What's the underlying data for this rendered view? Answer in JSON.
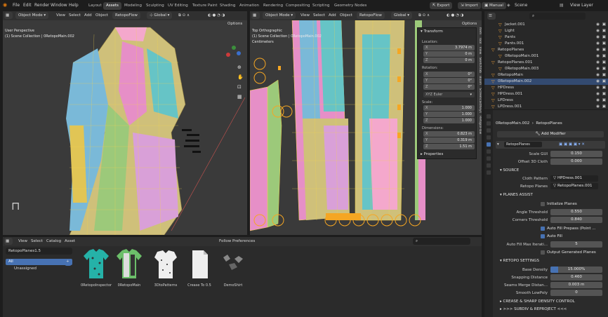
{
  "app": {
    "menus": [
      "File",
      "Edit",
      "Render",
      "Window",
      "Help"
    ],
    "workspaces": [
      "Layout",
      "Assets",
      "Modeling",
      "Sculpting",
      "UV Editing",
      "Texture Paint",
      "Shading",
      "Animation",
      "Rendering",
      "Compositing",
      "Scripting",
      "Geometry Nodes"
    ],
    "active_workspace": "Assets",
    "export": "Export",
    "import": "Import",
    "manual": "Manual",
    "scene": "Scene",
    "view_layer": "View Layer"
  },
  "vp_left": {
    "mode": "Object Mode",
    "menus": [
      "View",
      "Select",
      "Add",
      "Object"
    ],
    "tool": "RetopoFlow",
    "orient": "Global",
    "options": "Options",
    "overlay_title": "User Perspective",
    "overlay_sub": "(1) Scene Collection | 0RetopoMain.002"
  },
  "vp_right": {
    "mode": "Object Mode",
    "menus": [
      "View",
      "Select",
      "Add",
      "Object"
    ],
    "tool": "RetopoFlow",
    "orient": "Global",
    "options": "Options",
    "overlay_title": "Top Orthographic",
    "overlay_sub": "(1) Scene Collection | 0RetopoMain.002",
    "overlay_unit": "Centimeters",
    "side_tabs": [
      "Item",
      "Tool",
      "View",
      "Sketchfab",
      "Boom",
      "ScreencastKeys",
      "RetopoFlow"
    ]
  },
  "npanel": {
    "title": "Transform",
    "location_label": "Location:",
    "loc": [
      {
        "k": "X",
        "v": "3.7974 m"
      },
      {
        "k": "Y",
        "v": "0 m"
      },
      {
        "k": "Z",
        "v": "0 m"
      }
    ],
    "rotation_label": "Rotation:",
    "rot": [
      {
        "k": "X",
        "v": "0°"
      },
      {
        "k": "Y",
        "v": "0°"
      },
      {
        "k": "Z",
        "v": "0°"
      }
    ],
    "euler": "XYZ Euler",
    "scale_label": "Scale:",
    "scale": [
      {
        "k": "X",
        "v": "1.000"
      },
      {
        "k": "Y",
        "v": "1.000"
      },
      {
        "k": "Z",
        "v": "1.000"
      }
    ],
    "dim_label": "Dimensions:",
    "dim": [
      {
        "k": "X",
        "v": "0.823 m"
      },
      {
        "k": "Y",
        "v": "0.319 m"
      },
      {
        "k": "Z",
        "v": "1.51 m"
      }
    ],
    "properties": "Properties"
  },
  "outliner": {
    "search_placeholder": "",
    "rows": [
      {
        "name": "Jacket.001",
        "indent": 1,
        "sel": false
      },
      {
        "name": "Light",
        "indent": 1,
        "sel": false
      },
      {
        "name": "Pants",
        "indent": 1,
        "sel": false
      },
      {
        "name": "Pants.001",
        "indent": 1,
        "sel": false
      },
      {
        "name": "RetopoPlanes",
        "indent": 0,
        "sel": false
      },
      {
        "name": "0RetopoMain.001",
        "indent": 1,
        "sel": false
      },
      {
        "name": "RetopoPlanes.001",
        "indent": 0,
        "sel": false
      },
      {
        "name": "0RetopoMain.003",
        "indent": 1,
        "sel": false
      },
      {
        "name": "0RetopoMain",
        "indent": 0,
        "sel": false
      },
      {
        "name": "0RetopoMain.002",
        "indent": 0,
        "sel": true
      },
      {
        "name": "HPDress",
        "indent": 0,
        "sel": false
      },
      {
        "name": "HPDress.001",
        "indent": 0,
        "sel": false
      },
      {
        "name": "LPDress",
        "indent": 0,
        "sel": false
      },
      {
        "name": "LPDress.001",
        "indent": 0,
        "sel": false
      }
    ]
  },
  "props": {
    "breadcrumb_obj": "0RetopoMain.002",
    "breadcrumb_mod": "RetopoPlanes",
    "add_modifier": "Add Modifier",
    "modifier_name": "RetopoPlanes",
    "fields": [
      {
        "label": "Scale GUI",
        "value": "0.150"
      },
      {
        "label": "Offset 3D Cloth",
        "value": "0.000"
      }
    ],
    "source_header": "SOURCE",
    "cloth_pattern_label": "Cloth Pattern",
    "cloth_pattern": "HPDress.001",
    "retopo_planes_label": "Retopo Planes",
    "retopo_planes": "RetopoPlanes.001",
    "planes_assist_header": "PLANES ASSIST",
    "initialize_planes": "Initialize Planes",
    "angle_label": "Angle Threshold",
    "angle": "0.550",
    "corners_label": "Corners Threshold",
    "corners": "0.840",
    "auto_fill_prepass": "Auto Fill Prepass (Point ...",
    "auto_fill": "Auto Fill",
    "max_iter_label": "Auto Fill Max Iterati...",
    "max_iter": "5",
    "output_generated": "Output Generated Planes",
    "retopo_settings_header": "RETOPO SETTINGS",
    "base_density_label": "Base Density",
    "base_density": "15.000%",
    "base_density_frac": 0.15,
    "snapping_label": "Snapping Distance",
    "snapping": "0.460",
    "seams_label": "Seams Merge Distan...",
    "seams": "0.003 m",
    "smooth_label": "Smooth LowPoly",
    "smooth": "0",
    "crease_header": "CREASE & SHARP DENSITY CONTROL",
    "subdiv_header": ">>> SUBDIV & REPROJECT <<<"
  },
  "assets": {
    "menus": [
      "View",
      "Select",
      "Catalog",
      "Asset"
    ],
    "library": "RetopoPlanes1.5",
    "follow_prefs": "Follow Preferences",
    "all": "All",
    "unassigned": "Unassigned",
    "items": [
      {
        "name": "0RetopoInspector"
      },
      {
        "name": "0RetopoMain"
      },
      {
        "name": "3DtoPatterns"
      },
      {
        "name": "Crease To 0.5"
      },
      {
        "name": "DemoShirt"
      }
    ]
  },
  "colors": {
    "accent": "#4772b3",
    "select_orange": "#f5a623",
    "sel_row": "#334a70"
  }
}
